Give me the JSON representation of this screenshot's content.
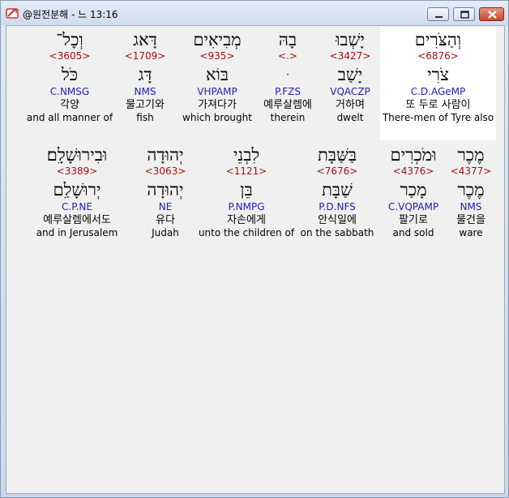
{
  "window": {
    "title": "@원전분해 - 느 13:16"
  },
  "rows": [
    {
      "words": [
        {
          "hebrew": "וְהַצֹּרִים",
          "strong": "<6876>",
          "lemma": "צֹרִי",
          "morph": "C.D.AGeMP",
          "korean": "또 두로 사람이",
          "english": "There-men of Tyre also"
        },
        {
          "hebrew": "יָשְׁבוּ",
          "strong": "<3427>",
          "lemma": "יָשַׁב",
          "morph": "VQACZP",
          "korean": "거하며",
          "english": "dwelt"
        },
        {
          "hebrew": "בָהּ",
          "strong": "<.>",
          "lemma": "ּ",
          "morph": "P.FZS",
          "korean": "예루살렘에",
          "english": "therein"
        },
        {
          "hebrew": "מְבִיאִים",
          "strong": "<935>",
          "lemma": "בּוֹא",
          "morph": "VHPAMP",
          "korean": "가져다가",
          "english": "which brought"
        },
        {
          "hebrew": "דָּאג",
          "strong": "<1709>",
          "lemma": "דָּג",
          "morph": "NMS",
          "korean": "물고기와",
          "english": "fish"
        },
        {
          "hebrew": "וְכָל־",
          "strong": "<3605>",
          "lemma": "כֹּל",
          "morph": "C.NMSG",
          "korean": "각양",
          "english": "and all manner of"
        }
      ]
    },
    {
      "words": [
        {
          "hebrew": "מֶכֶר",
          "strong": "<4377>",
          "lemma": "מֶכֶר",
          "morph": "NMS",
          "korean": "물건을",
          "english": "ware"
        },
        {
          "hebrew": "וּמֹכְרִים",
          "strong": "<4376>",
          "lemma": "מָכַר",
          "morph": "C.VQPAMP",
          "korean": "팔기로",
          "english": "and sold"
        },
        {
          "hebrew": "בַּשַּׁבָּת",
          "strong": "<7676>",
          "lemma": "שַׁבָּת",
          "morph": "P.D.NFS",
          "korean": "안식일에",
          "english": "on the sabbath"
        },
        {
          "hebrew": "לִבְנֵי",
          "strong": "<1121>",
          "lemma": "בֵּן",
          "morph": "P.NMPG",
          "korean": "자손에게",
          "english": "unto the children of"
        },
        {
          "hebrew": "יְהוּדָה",
          "strong": "<3063>",
          "lemma": "יְהוּדָה",
          "morph": "NE",
          "korean": "유다",
          "english": "Judah"
        },
        {
          "hebrew": "וּבִירוּשָׁלִָם׃",
          "strong": "<3389>",
          "lemma": "יְרוּשָׁלִַם",
          "morph": "C.P.NE",
          "korean": "예루살렘에서도",
          "english": "and in Jerusalem"
        }
      ]
    }
  ]
}
